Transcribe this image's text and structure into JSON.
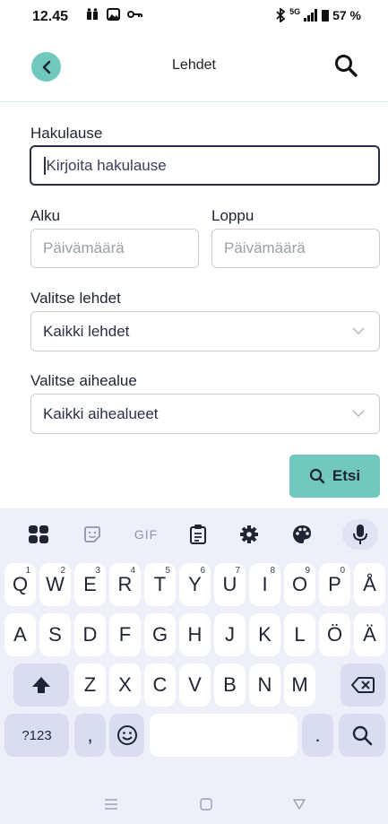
{
  "status_bar": {
    "time": "12.45",
    "left_icons": [
      "notification-icon",
      "gallery-icon",
      "key-icon"
    ],
    "right_icons": [
      "bluetooth-icon",
      "signal-icon",
      "battery-icon"
    ],
    "network": "5G",
    "battery": "57 %"
  },
  "header": {
    "title": "Lehdet"
  },
  "form": {
    "query_label": "Hakulause",
    "query_placeholder": "Kirjoita hakulause",
    "start_label": "Alku",
    "start_placeholder": "Päivämäärä",
    "end_label": "Loppu",
    "end_placeholder": "Päivämäärä",
    "journals_label": "Valitse lehdet",
    "journals_value": "Kaikki lehdet",
    "subject_label": "Valitse aihealue",
    "subject_value": "Kaikki aihealueet",
    "search_button": "Etsi"
  },
  "keyboard": {
    "toolbar": [
      "apps-icon",
      "sticker-icon",
      "GIF",
      "clipboard-icon",
      "settings-icon",
      "palette-icon",
      "mic-icon"
    ],
    "row1": [
      {
        "k": "Q",
        "h": "1"
      },
      {
        "k": "W",
        "h": "2"
      },
      {
        "k": "E",
        "h": "3"
      },
      {
        "k": "R",
        "h": "4"
      },
      {
        "k": "T",
        "h": "5"
      },
      {
        "k": "Y",
        "h": "6"
      },
      {
        "k": "U",
        "h": "7"
      },
      {
        "k": "I",
        "h": "8"
      },
      {
        "k": "O",
        "h": "9"
      },
      {
        "k": "P",
        "h": "0"
      },
      {
        "k": "Å",
        "h": ""
      }
    ],
    "row2": [
      "A",
      "S",
      "D",
      "F",
      "G",
      "H",
      "J",
      "K",
      "L",
      "Ö",
      "Ä"
    ],
    "row3": [
      "Z",
      "X",
      "C",
      "V",
      "B",
      "N",
      "M"
    ],
    "symbols": "?123",
    "comma": ",",
    "period": "."
  },
  "colors": {
    "accent": "#71c9bd",
    "text": "#1f2433",
    "keyboard_bg": "#eef0f9",
    "special_key": "#d9ddf1"
  }
}
